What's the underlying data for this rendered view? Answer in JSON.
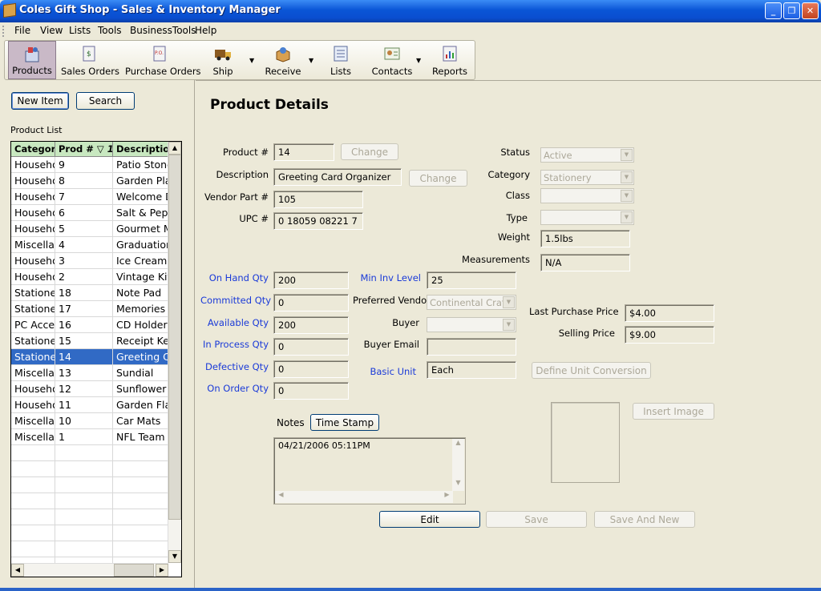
{
  "window": {
    "title": "Coles Gift Shop - Sales & Inventory Manager",
    "min": "_",
    "max": "❐",
    "close": "✕"
  },
  "menu": [
    "File",
    "View",
    "Lists",
    "Tools",
    "BusinessTools",
    "Help"
  ],
  "toolbar": [
    {
      "label": "Products",
      "icon": "products-icon",
      "active": true
    },
    {
      "label": "Sales Orders",
      "icon": "sales-orders-icon"
    },
    {
      "label": "Purchase Orders",
      "icon": "purchase-orders-icon"
    },
    {
      "label": "Ship",
      "icon": "ship-truck-icon",
      "dropdown": true
    },
    {
      "label": "Receive",
      "icon": "receive-box-icon",
      "dropdown": true
    },
    {
      "label": "Lists",
      "icon": "lists-icon"
    },
    {
      "label": "Contacts",
      "icon": "contacts-icon",
      "dropdown": true
    },
    {
      "label": "Reports",
      "icon": "reports-chart-icon"
    }
  ],
  "left": {
    "new_item": "New Item",
    "search": "Search",
    "list_label": "Product List",
    "columns": [
      "Category",
      "Prod #",
      "Description"
    ],
    "sort_indicator": "1",
    "rows": [
      [
        "Househo",
        "9",
        "Patio Stone"
      ],
      [
        "Househo",
        "8",
        "Garden Pla"
      ],
      [
        "Househo",
        "7",
        "Welcome D"
      ],
      [
        "Househo",
        "6",
        "Salt & Pep"
      ],
      [
        "Househo",
        "5",
        "Gourmet M"
      ],
      [
        "Miscella",
        "4",
        "Graduation"
      ],
      [
        "Househo",
        "3",
        "Ice Cream"
      ],
      [
        "Househo",
        "2",
        "Vintage Kit"
      ],
      [
        "Statione",
        "18",
        "Note Pad"
      ],
      [
        "Statione",
        "17",
        "Memories A"
      ],
      [
        "PC Acce",
        "16",
        "CD Holder"
      ],
      [
        "Statione",
        "15",
        "Receipt Ke"
      ],
      [
        "Statione",
        "14",
        "Greeting C"
      ],
      [
        "Miscella",
        "13",
        "Sundial"
      ],
      [
        "Househo",
        "12",
        "Sunflower F"
      ],
      [
        "Househo",
        "11",
        "Garden Fla"
      ],
      [
        "Miscella",
        "10",
        "Car Mats"
      ],
      [
        "Miscella",
        "1",
        "NFL Team"
      ]
    ],
    "selected_index": 12
  },
  "details": {
    "heading": "Product Details",
    "product_no": {
      "label": "Product #",
      "value": "14",
      "change": "Change"
    },
    "description": {
      "label": "Description",
      "value": "Greeting Card Organizer",
      "change": "Change"
    },
    "vendor_part": {
      "label": "Vendor Part #",
      "value": "105"
    },
    "upc": {
      "label": "UPC #",
      "value": "0 18059 08221 7"
    },
    "status": {
      "label": "Status",
      "value": "Active"
    },
    "category": {
      "label": "Category",
      "value": "Stationery"
    },
    "class": {
      "label": "Class",
      "value": ""
    },
    "type": {
      "label": "Type",
      "value": ""
    },
    "weight": {
      "label": "Weight",
      "value": "1.5lbs"
    },
    "measurements": {
      "label": "Measurements",
      "value": "N/A"
    },
    "on_hand": {
      "label": "On Hand Qty",
      "value": "200"
    },
    "committed": {
      "label": "Committed Qty",
      "value": "0"
    },
    "available": {
      "label": "Available Qty",
      "value": "200"
    },
    "in_process": {
      "label": "In Process Qty",
      "value": "0"
    },
    "defective": {
      "label": "Defective Qty",
      "value": "0"
    },
    "on_order": {
      "label": "On Order Qty",
      "value": "0"
    },
    "min_inv": {
      "label": "Min Inv Level",
      "value": "25"
    },
    "pref_vendor": {
      "label": "Preferred Vendor",
      "value": "Continental Craft I"
    },
    "buyer": {
      "label": "Buyer",
      "value": ""
    },
    "buyer_email": {
      "label": "Buyer Email",
      "value": ""
    },
    "basic_unit": {
      "label": "Basic Unit",
      "value": "Each"
    },
    "define_unit": "Define Unit Conversion",
    "last_purchase": {
      "label": "Last Purchase Price",
      "value": "$4.00"
    },
    "selling": {
      "label": "Selling Price",
      "value": "$9.00"
    },
    "notes_label": "Notes",
    "time_stamp": "Time Stamp",
    "notes_text": "04/21/2006 05:11PM",
    "insert_image": "Insert Image",
    "edit": "Edit",
    "save": "Save",
    "save_new": "Save And New"
  }
}
